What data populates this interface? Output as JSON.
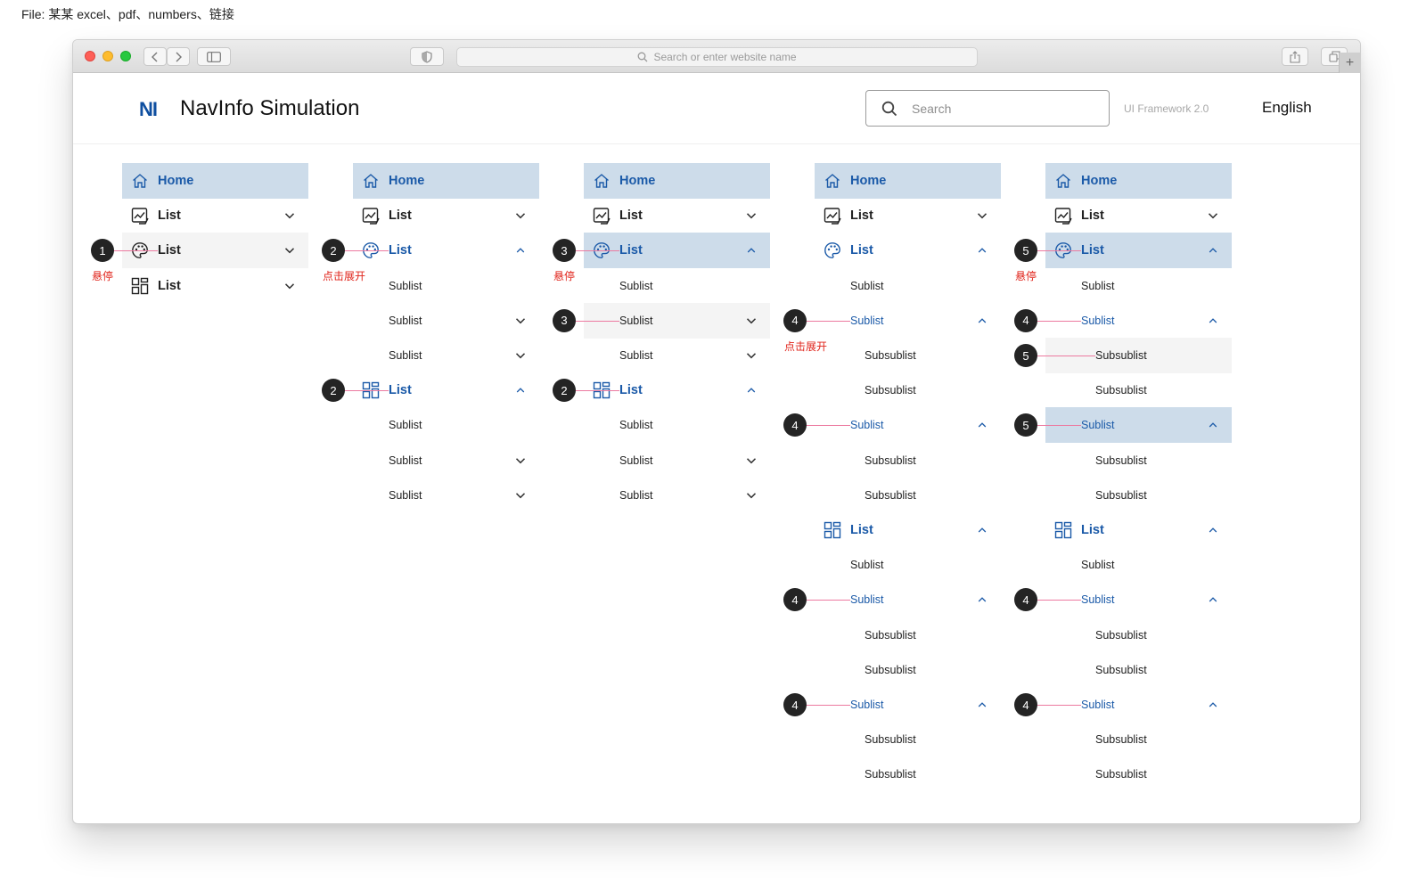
{
  "file_label": "File: 某某 excel、pdf、numbers、链接",
  "browser": {
    "address_placeholder": "Search or enter website name"
  },
  "header": {
    "logo": "NI",
    "title": "NavInfo Simulation",
    "search_placeholder": "Search",
    "framework": "UI Framework 2.0",
    "language": "English"
  },
  "annotations": {
    "hover": "悬停",
    "click_expand": "点击展开"
  },
  "columns": [
    {
      "items": [
        {
          "label": "Home",
          "icon": "home-icon",
          "level": 0,
          "state": "selected",
          "chevron": "none"
        },
        {
          "label": "List",
          "icon": "chart-icon",
          "level": 0,
          "state": "normal",
          "chevron": "down"
        },
        {
          "label": "List",
          "icon": "palette-icon",
          "level": 0,
          "state": "hover",
          "chevron": "down"
        },
        {
          "label": "List",
          "icon": "grid-icon",
          "level": 0,
          "state": "normal",
          "chevron": "down"
        }
      ],
      "badges": [
        {
          "row": 2,
          "n": "1",
          "note": "hover"
        }
      ]
    },
    {
      "items": [
        {
          "label": "Home",
          "icon": "home-icon",
          "level": 0,
          "state": "selected",
          "chevron": "none"
        },
        {
          "label": "List",
          "icon": "chart-icon",
          "level": 0,
          "state": "normal",
          "chevron": "down"
        },
        {
          "label": "List",
          "icon": "palette-icon",
          "level": 0,
          "state": "blue",
          "chevron": "up"
        },
        {
          "label": "Sublist",
          "level": 1,
          "state": "normal",
          "chevron": "none"
        },
        {
          "label": "Sublist",
          "level": 1,
          "state": "normal",
          "chevron": "down"
        },
        {
          "label": "Sublist",
          "level": 1,
          "state": "normal",
          "chevron": "down"
        },
        {
          "label": "List",
          "icon": "grid-icon",
          "level": 0,
          "state": "blue",
          "chevron": "up"
        },
        {
          "label": "Sublist",
          "level": 1,
          "state": "normal",
          "chevron": "none"
        },
        {
          "label": "Sublist",
          "level": 1,
          "state": "normal",
          "chevron": "down"
        },
        {
          "label": "Sublist",
          "level": 1,
          "state": "normal",
          "chevron": "down"
        }
      ],
      "badges": [
        {
          "row": 2,
          "n": "2",
          "note": "click_expand"
        },
        {
          "row": 6,
          "n": "2"
        }
      ]
    },
    {
      "items": [
        {
          "label": "Home",
          "icon": "home-icon",
          "level": 0,
          "state": "selected",
          "chevron": "none"
        },
        {
          "label": "List",
          "icon": "chart-icon",
          "level": 0,
          "state": "normal",
          "chevron": "down"
        },
        {
          "label": "List",
          "icon": "palette-icon",
          "level": 0,
          "state": "selected-blue",
          "chevron": "up"
        },
        {
          "label": "Sublist",
          "level": 1,
          "state": "normal",
          "chevron": "none"
        },
        {
          "label": "Sublist",
          "level": 1,
          "state": "hover",
          "chevron": "down"
        },
        {
          "label": "Sublist",
          "level": 1,
          "state": "normal",
          "chevron": "down"
        },
        {
          "label": "List",
          "icon": "grid-icon",
          "level": 0,
          "state": "blue",
          "chevron": "up"
        },
        {
          "label": "Sublist",
          "level": 1,
          "state": "normal",
          "chevron": "none"
        },
        {
          "label": "Sublist",
          "level": 1,
          "state": "normal",
          "chevron": "down"
        },
        {
          "label": "Sublist",
          "level": 1,
          "state": "normal",
          "chevron": "down"
        }
      ],
      "badges": [
        {
          "row": 2,
          "n": "3",
          "note": "hover"
        },
        {
          "row": 4,
          "n": "3"
        },
        {
          "row": 6,
          "n": "2"
        }
      ]
    },
    {
      "items": [
        {
          "label": "Home",
          "icon": "home-icon",
          "level": 0,
          "state": "selected",
          "chevron": "none"
        },
        {
          "label": "List",
          "icon": "chart-icon",
          "level": 0,
          "state": "normal",
          "chevron": "down"
        },
        {
          "label": "List",
          "icon": "palette-icon",
          "level": 0,
          "state": "blue",
          "chevron": "up"
        },
        {
          "label": "Sublist",
          "level": 1,
          "state": "normal",
          "chevron": "none"
        },
        {
          "label": "Sublist",
          "level": 1,
          "state": "blue",
          "chevron": "up"
        },
        {
          "label": "Subsublist",
          "level": 2,
          "state": "normal",
          "chevron": "none"
        },
        {
          "label": "Subsublist",
          "level": 2,
          "state": "normal",
          "chevron": "none"
        },
        {
          "label": "Sublist",
          "level": 1,
          "state": "blue",
          "chevron": "up"
        },
        {
          "label": "Subsublist",
          "level": 2,
          "state": "normal",
          "chevron": "none"
        },
        {
          "label": "Subsublist",
          "level": 2,
          "state": "normal",
          "chevron": "none"
        },
        {
          "label": "List",
          "icon": "grid-icon",
          "level": 0,
          "state": "blue",
          "chevron": "up"
        },
        {
          "label": "Sublist",
          "level": 1,
          "state": "normal",
          "chevron": "none"
        },
        {
          "label": "Sublist",
          "level": 1,
          "state": "blue",
          "chevron": "up"
        },
        {
          "label": "Subsublist",
          "level": 2,
          "state": "normal",
          "chevron": "none"
        },
        {
          "label": "Subsublist",
          "level": 2,
          "state": "normal",
          "chevron": "none"
        },
        {
          "label": "Sublist",
          "level": 1,
          "state": "blue",
          "chevron": "up"
        },
        {
          "label": "Subsublist",
          "level": 2,
          "state": "normal",
          "chevron": "none"
        },
        {
          "label": "Subsublist",
          "level": 2,
          "state": "normal",
          "chevron": "none"
        }
      ],
      "badges": [
        {
          "row": 4,
          "n": "4",
          "note": "click_expand"
        },
        {
          "row": 7,
          "n": "4"
        },
        {
          "row": 12,
          "n": "4"
        },
        {
          "row": 15,
          "n": "4"
        }
      ]
    },
    {
      "items": [
        {
          "label": "Home",
          "icon": "home-icon",
          "level": 0,
          "state": "selected",
          "chevron": "none"
        },
        {
          "label": "List",
          "icon": "chart-icon",
          "level": 0,
          "state": "normal",
          "chevron": "down"
        },
        {
          "label": "List",
          "icon": "palette-icon",
          "level": 0,
          "state": "selected-blue",
          "chevron": "up"
        },
        {
          "label": "Sublist",
          "level": 1,
          "state": "normal",
          "chevron": "none"
        },
        {
          "label": "Sublist",
          "level": 1,
          "state": "blue",
          "chevron": "up"
        },
        {
          "label": "Subsublist",
          "level": 2,
          "state": "hover",
          "chevron": "none"
        },
        {
          "label": "Subsublist",
          "level": 2,
          "state": "normal",
          "chevron": "none"
        },
        {
          "label": "Sublist",
          "level": 1,
          "state": "selected-blue",
          "chevron": "up"
        },
        {
          "label": "Subsublist",
          "level": 2,
          "state": "normal",
          "chevron": "none"
        },
        {
          "label": "Subsublist",
          "level": 2,
          "state": "normal",
          "chevron": "none"
        },
        {
          "label": "List",
          "icon": "grid-icon",
          "level": 0,
          "state": "blue",
          "chevron": "up"
        },
        {
          "label": "Sublist",
          "level": 1,
          "state": "normal",
          "chevron": "none"
        },
        {
          "label": "Sublist",
          "level": 1,
          "state": "blue",
          "chevron": "up"
        },
        {
          "label": "Subsublist",
          "level": 2,
          "state": "normal",
          "chevron": "none"
        },
        {
          "label": "Subsublist",
          "level": 2,
          "state": "normal",
          "chevron": "none"
        },
        {
          "label": "Sublist",
          "level": 1,
          "state": "blue",
          "chevron": "up"
        },
        {
          "label": "Subsublist",
          "level": 2,
          "state": "normal",
          "chevron": "none"
        },
        {
          "label": "Subsublist",
          "level": 2,
          "state": "normal",
          "chevron": "none"
        }
      ],
      "badges": [
        {
          "row": 2,
          "n": "5",
          "note": "hover"
        },
        {
          "row": 4,
          "n": "4"
        },
        {
          "row": 5,
          "n": "5"
        },
        {
          "row": 7,
          "n": "5"
        },
        {
          "row": 12,
          "n": "4"
        },
        {
          "row": 15,
          "n": "4"
        }
      ]
    }
  ],
  "colors": {
    "accent": "#1b5aa8",
    "selected_bg": "#cddcea",
    "hover_bg": "#f4f4f4",
    "annotation": "#e0241b",
    "guide_line": "#ec7aa0"
  }
}
